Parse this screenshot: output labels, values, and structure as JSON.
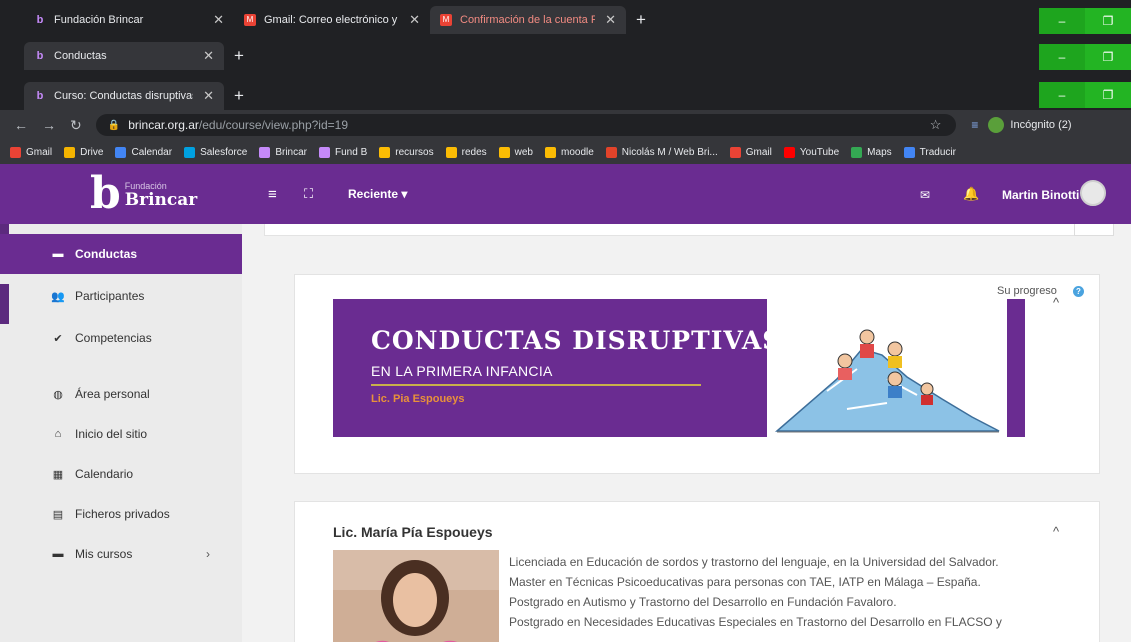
{
  "browser": {
    "window_tabs": [
      {
        "label": "Fundación Brincar",
        "icon": "brincar-favicon",
        "active": false
      },
      {
        "label": "Gmail: Correo electrónico y alma",
        "icon": "gmail-favicon",
        "active": false
      },
      {
        "label": "Confirmación de la cuenta Funda",
        "icon": "gmail-favicon",
        "active": true
      }
    ],
    "window2_tab": {
      "label": "Conductas",
      "icon": "brincar-favicon"
    },
    "window3_tab": {
      "label": "Curso: Conductas disruptivas en",
      "icon": "brincar-favicon"
    },
    "url": {
      "domain": "brincar.org.ar",
      "path": "/edu/course/view.php?id=19"
    },
    "incognito_label": "Incógnito (2)",
    "bookmarks": [
      {
        "label": "Gmail",
        "color": "#ea4335"
      },
      {
        "label": "Drive",
        "color": "#f4b400"
      },
      {
        "label": "Calendar",
        "color": "#4285f4"
      },
      {
        "label": "Salesforce",
        "color": "#00a1e0"
      },
      {
        "label": "Brincar",
        "color": "#c58af9"
      },
      {
        "label": "Fund B",
        "color": "#c58af9"
      },
      {
        "label": "recursos",
        "color": "#fbbc04"
      },
      {
        "label": "redes",
        "color": "#fbbc04"
      },
      {
        "label": "web",
        "color": "#fbbc04"
      },
      {
        "label": "moodle",
        "color": "#fbbc04"
      },
      {
        "label": "Nicolás M / Web Bri...",
        "color": "#e2432a"
      },
      {
        "label": "Gmail",
        "color": "#ea4335"
      },
      {
        "label": "YouTube",
        "color": "#ff0000"
      },
      {
        "label": "Maps",
        "color": "#34a853"
      },
      {
        "label": "Traducir",
        "color": "#4285f4"
      }
    ]
  },
  "header": {
    "logo_small": "Fundación",
    "logo_name": "Brincar",
    "logo_letter": "b",
    "recent_label": "Reciente ▾",
    "user_name": "Martin Binotti"
  },
  "drawer": {
    "items": [
      {
        "label": "Conductas",
        "icon": "course-icon",
        "active": true
      },
      {
        "label": "Participantes",
        "icon": "users-icon"
      },
      {
        "label": "Competencias",
        "icon": "check-circle-icon"
      },
      {
        "label": "Área personal",
        "icon": "dashboard-icon"
      },
      {
        "label": "Inicio del sitio",
        "icon": "home-icon"
      },
      {
        "label": "Calendario",
        "icon": "calendar-icon"
      },
      {
        "label": "Ficheros privados",
        "icon": "files-icon"
      },
      {
        "label": "Mis cursos",
        "icon": "course-icon"
      }
    ]
  },
  "course": {
    "progress_label": "Su progreso",
    "banner_title": "CONDUCTAS DISRUPTIVAS",
    "banner_subtitle": "EN LA PRIMERA INFANCIA",
    "banner_author": "Lic. Pia Espoueys",
    "section_title": "Lic. María Pía Espoueys",
    "bio_lines": [
      "Licenciada en Educación de sordos y trastorno del lenguaje, en la Universidad del Salvador.",
      "Master en Técnicas Psicoeducativas para personas con TAE, IATP en Málaga – España.",
      "Postgrado en Autismo y Trastorno del Desarrollo en Fundación Favaloro.",
      "Postgrado en Necesidades Educativas Especiales en Trastorno del Desarrollo en FLACSO y"
    ]
  },
  "colors": {
    "brand": "#6a2c91",
    "accent_gold": "#c8b04a",
    "author_orange": "#e9913a"
  }
}
